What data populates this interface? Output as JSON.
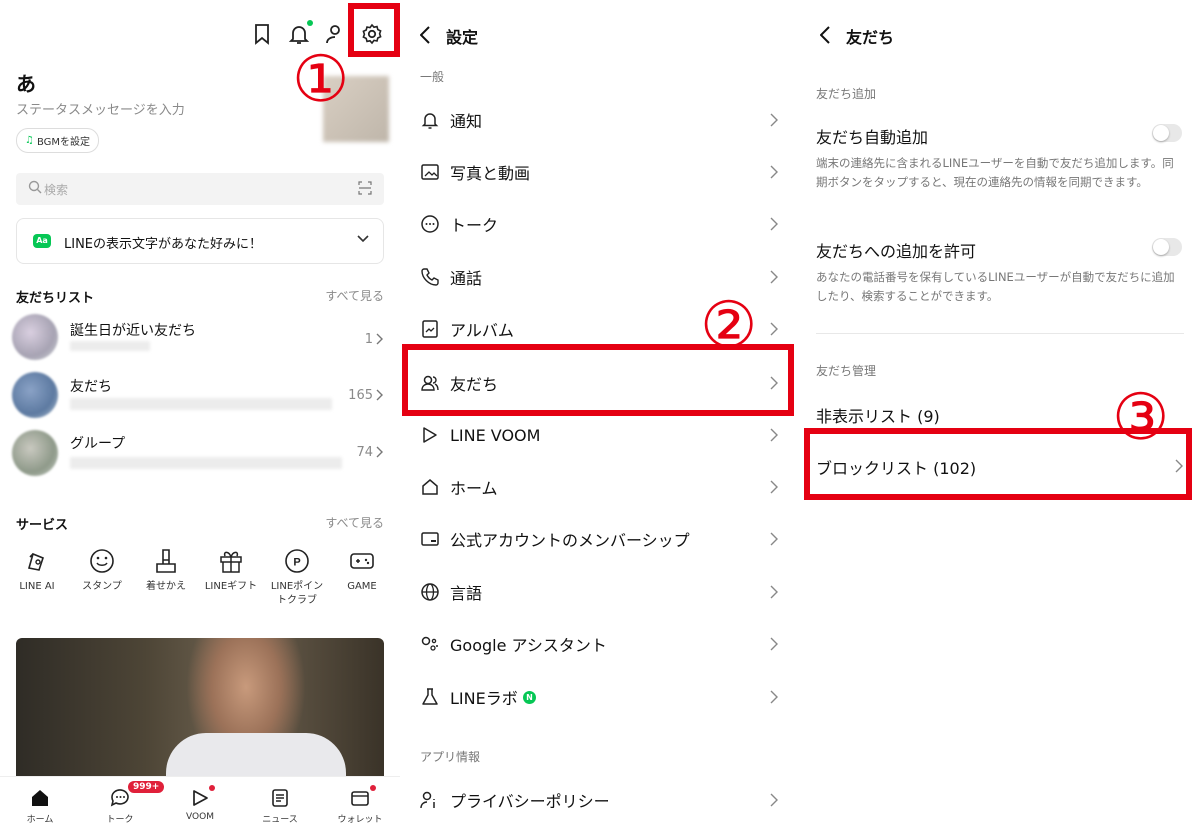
{
  "home": {
    "profile_name": "あ",
    "status_placeholder": "ステータスメッセージを入力",
    "bgm_label": "BGMを設定",
    "search_placeholder": "検索",
    "banner_text": "LINEの表示文字があなた好みに！",
    "friends_list": {
      "title": "友だちリスト",
      "see_all": "すべて見る",
      "items": [
        {
          "label": "誕生日が近い友だち",
          "count": "1"
        },
        {
          "label": "友だち",
          "count": "165"
        },
        {
          "label": "グループ",
          "count": "74"
        }
      ]
    },
    "services": {
      "title": "サービス",
      "see_all": "すべて見る",
      "items": [
        {
          "label": "LINE AI",
          "icon": "ai-icon"
        },
        {
          "label": "スタンプ",
          "icon": "smile-icon"
        },
        {
          "label": "着せかえ",
          "icon": "brush-icon"
        },
        {
          "label": "LINEギフト",
          "icon": "gift-icon"
        },
        {
          "label": "LINEポイントクラブ",
          "icon": "points-icon"
        },
        {
          "label": "GAME",
          "icon": "game-icon"
        }
      ]
    },
    "bottom_nav": [
      {
        "label": "ホーム",
        "icon": "home-icon"
      },
      {
        "label": "トーク",
        "icon": "chat-icon",
        "badge": "999+"
      },
      {
        "label": "VOOM",
        "icon": "voom-icon"
      },
      {
        "label": "ニュース",
        "icon": "news-icon"
      },
      {
        "label": "ウォレット",
        "icon": "wallet-icon"
      }
    ]
  },
  "settings": {
    "title": "設定",
    "section_general": "一般",
    "items": [
      {
        "label": "通知",
        "icon": "bell-icon"
      },
      {
        "label": "写真と動画",
        "icon": "photo-icon"
      },
      {
        "label": "トーク",
        "icon": "chat-icon"
      },
      {
        "label": "通話",
        "icon": "phone-icon"
      },
      {
        "label": "アルバム",
        "icon": "album-icon"
      },
      {
        "label": "友だち",
        "icon": "friends-icon"
      },
      {
        "label": "LINE VOOM",
        "icon": "voom-icon"
      },
      {
        "label": "ホーム",
        "icon": "home-icon"
      },
      {
        "label": "公式アカウントのメンバーシップ",
        "icon": "membership-icon"
      },
      {
        "label": "言語",
        "icon": "globe-icon"
      },
      {
        "label": "Google アシスタント",
        "icon": "assistant-icon"
      },
      {
        "label": "LINEラボ",
        "icon": "flask-icon",
        "badge": "N"
      }
    ],
    "section_app_info": "アプリ情報",
    "privacy_policy": "プライバシーポリシー"
  },
  "friends_settings": {
    "title": "友だち",
    "section_add": "友だち追加",
    "auto_add": {
      "label": "友だち自動追加",
      "desc": "端末の連絡先に含まれるLINEユーザーを自動で友だち追加します。同期ボタンをタップすると、現在の連絡先の情報を同期できます。"
    },
    "allow_add": {
      "label": "友だちへの追加を許可",
      "desc": "あなたの電話番号を保有しているLINEユーザーが自動で友だちに追加したり、検索することができます。"
    },
    "section_manage": "友だち管理",
    "hidden_list": "非表示リスト (9)",
    "block_list": "ブロックリスト (102)"
  },
  "annotations": {
    "step1": "①",
    "step2": "②",
    "step3": "③",
    "highlight_color": "#e50012"
  },
  "colors": {
    "line_green": "#06c755",
    "badge_red": "#e0203a"
  }
}
